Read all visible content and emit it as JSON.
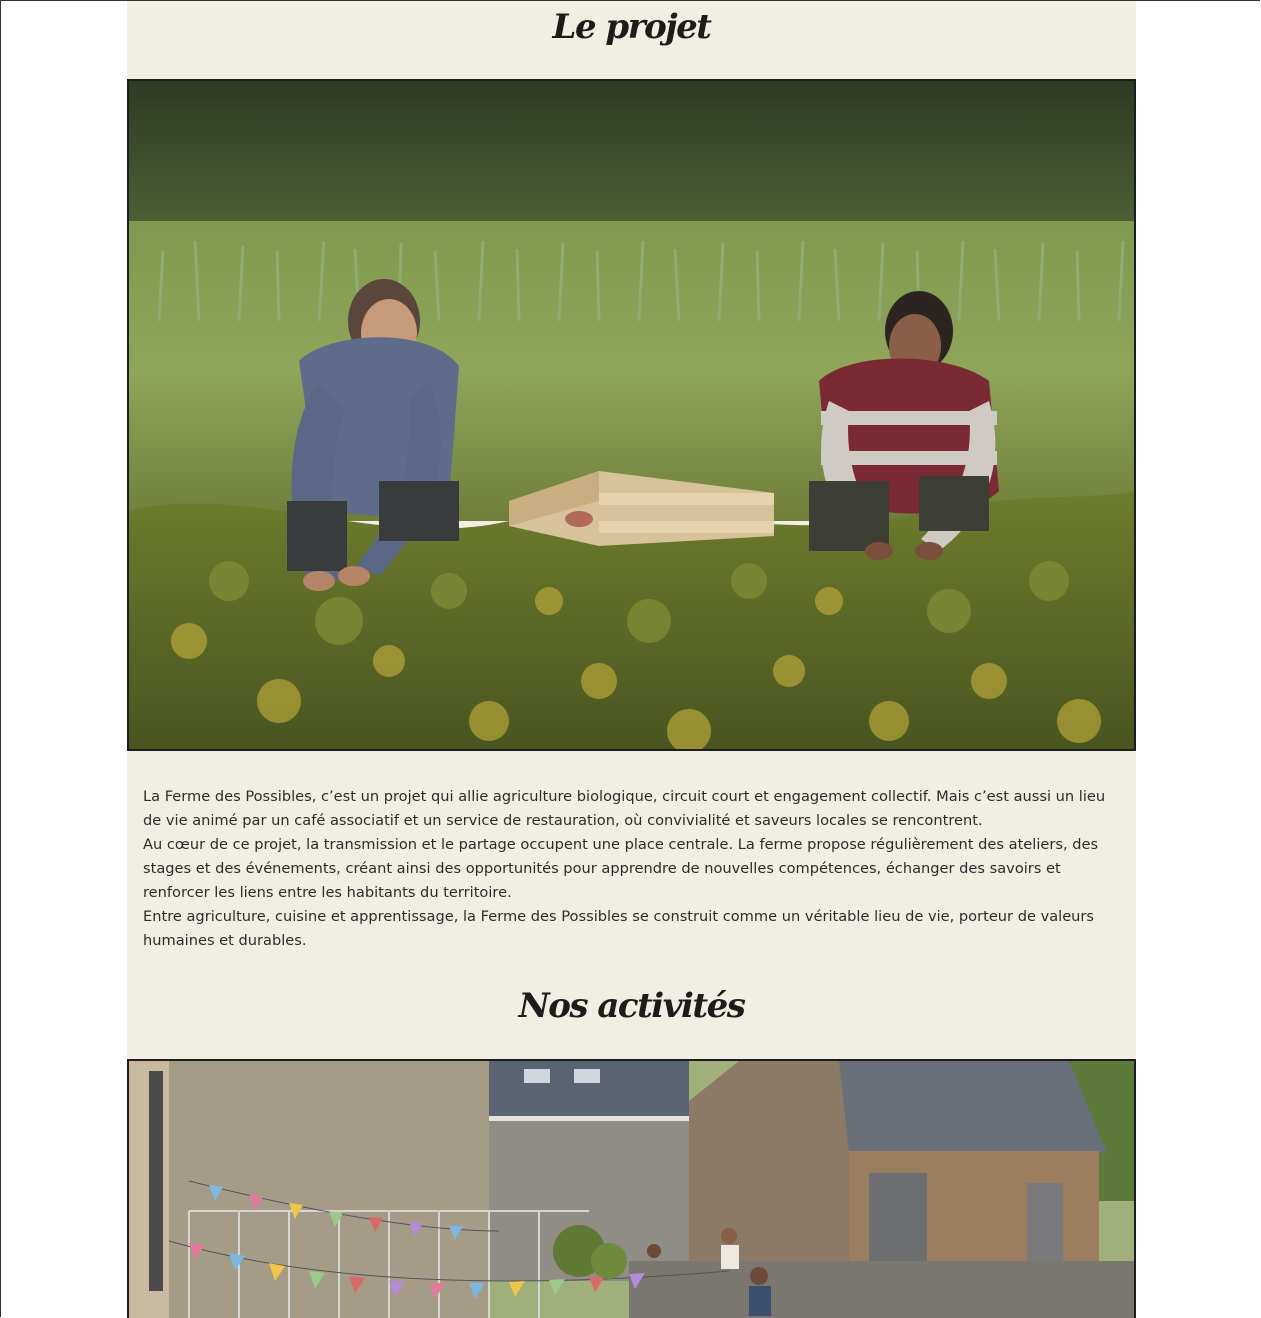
{
  "sections": {
    "projet": {
      "title": "Le projet",
      "paragraphs": [
        "La Ferme des Possibles, c’est un projet qui allie agriculture biologique, circuit court et engagement collectif. Mais c’est aussi un lieu de vie animé par un café associatif et un service de restauration, où convivialité et saveurs locales se rencontrent.",
        "Au cœur de ce projet, la transmission et le partage occupent une place centrale. La ferme propose régulièrement des ateliers, des stages et des événements, créant ainsi des opportunités pour apprendre de nouvelles compétences, échanger des savoirs et renforcer les liens entre les habitants du territoire.",
        "Entre agriculture, cuisine et apprentissage, la Ferme des Possibles se construit comme un véritable lieu de vie, porteur de valeurs humaines et durables."
      ]
    },
    "activites": {
      "title": "Nos activités"
    }
  },
  "colors": {
    "page_background": "#ffffff",
    "section_background": "#f1efe4",
    "heading_text": "#1e1b1b",
    "body_text": "#2b2b2b",
    "photo_border": "#1d1d1d"
  }
}
